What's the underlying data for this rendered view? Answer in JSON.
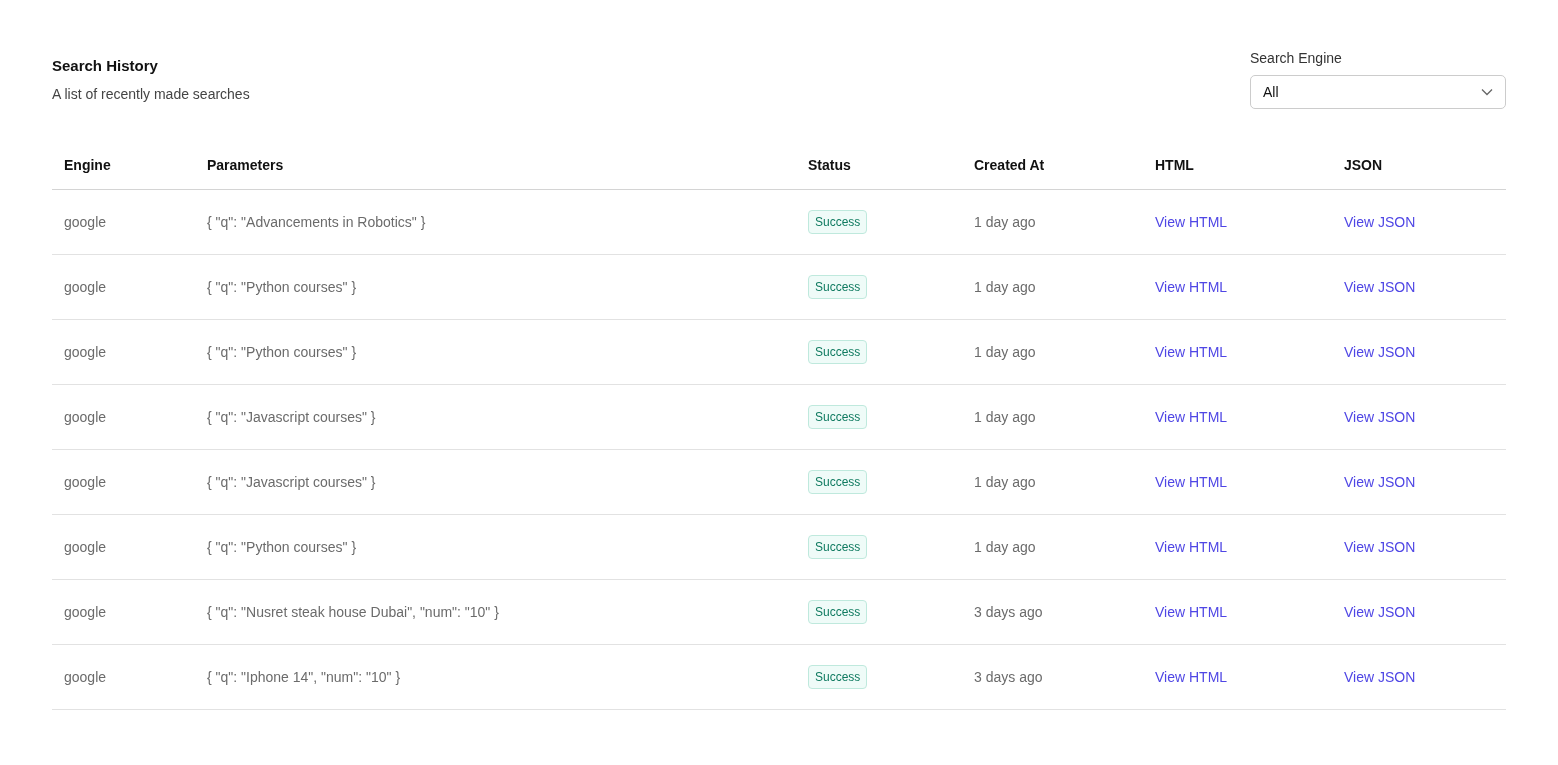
{
  "header": {
    "title": "Search History",
    "subtitle": "A list of recently made searches"
  },
  "filter": {
    "label": "Search Engine",
    "value": "All"
  },
  "table": {
    "columns": [
      "Engine",
      "Parameters",
      "Status",
      "Created At",
      "HTML",
      "JSON"
    ],
    "rows": [
      {
        "engine": "google",
        "parameters": "{ \"q\": \"Advancements in Robotics\" }",
        "status": "Success",
        "created": "1 day ago",
        "html": "View HTML",
        "json": "View JSON"
      },
      {
        "engine": "google",
        "parameters": "{ \"q\": \"Python courses\" }",
        "status": "Success",
        "created": "1 day ago",
        "html": "View HTML",
        "json": "View JSON"
      },
      {
        "engine": "google",
        "parameters": "{ \"q\": \"Python courses\" }",
        "status": "Success",
        "created": "1 day ago",
        "html": "View HTML",
        "json": "View JSON"
      },
      {
        "engine": "google",
        "parameters": "{ \"q\": \"Javascript courses\" }",
        "status": "Success",
        "created": "1 day ago",
        "html": "View HTML",
        "json": "View JSON"
      },
      {
        "engine": "google",
        "parameters": "{ \"q\": \"Javascript courses\" }",
        "status": "Success",
        "created": "1 day ago",
        "html": "View HTML",
        "json": "View JSON"
      },
      {
        "engine": "google",
        "parameters": "{ \"q\": \"Python courses\" }",
        "status": "Success",
        "created": "1 day ago",
        "html": "View HTML",
        "json": "View JSON"
      },
      {
        "engine": "google",
        "parameters": "{ \"q\": \"Nusret steak house Dubai\", \"num\": \"10\" }",
        "status": "Success",
        "created": "3 days ago",
        "html": "View HTML",
        "json": "View JSON"
      },
      {
        "engine": "google",
        "parameters": "{ \"q\": \"Iphone 14\", \"num\": \"10\" }",
        "status": "Success",
        "created": "3 days ago",
        "html": "View HTML",
        "json": "View JSON"
      }
    ]
  }
}
